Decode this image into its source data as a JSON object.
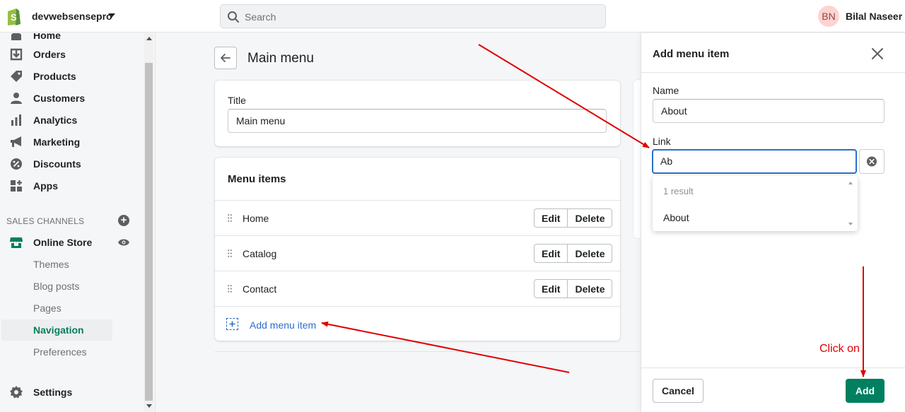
{
  "topbar": {
    "store_name": "devwebsensepro",
    "search_placeholder": "Search",
    "user_initials": "BN",
    "user_name": "Bilal Naseer"
  },
  "sidebar": {
    "items": [
      {
        "label": "Home",
        "icon": "home-icon"
      },
      {
        "label": "Orders",
        "icon": "orders-icon"
      },
      {
        "label": "Products",
        "icon": "tag-icon"
      },
      {
        "label": "Customers",
        "icon": "person-icon"
      },
      {
        "label": "Analytics",
        "icon": "bar-chart-icon"
      },
      {
        "label": "Marketing",
        "icon": "megaphone-icon"
      },
      {
        "label": "Discounts",
        "icon": "discount-icon"
      },
      {
        "label": "Apps",
        "icon": "apps-icon"
      }
    ],
    "section_header": "SALES CHANNELS",
    "channel": "Online Store",
    "sub_items": [
      "Themes",
      "Blog posts",
      "Pages",
      "Navigation",
      "Preferences"
    ],
    "active_sub_item": "Navigation",
    "settings_label": "Settings"
  },
  "main": {
    "page_title": "Main menu",
    "title_label": "Title",
    "title_value": "Main menu",
    "menu_items_header": "Menu items",
    "menu_items": [
      {
        "name": "Home",
        "edit": "Edit",
        "delete": "Delete"
      },
      {
        "name": "Catalog",
        "edit": "Edit",
        "delete": "Delete"
      },
      {
        "name": "Contact",
        "edit": "Edit",
        "delete": "Delete"
      }
    ],
    "add_menu_item": "Add menu item"
  },
  "panel": {
    "title": "Add menu item",
    "name_label": "Name",
    "name_value": "About",
    "link_label": "Link",
    "link_value": "Ab",
    "result_count": "1 result",
    "result_option": "About",
    "cancel_label": "Cancel",
    "add_label": "Add"
  },
  "annotation": {
    "text": "Click on",
    "color": "#e00000"
  },
  "colors": {
    "brand_green": "#008060",
    "active_nav": "#007f5f",
    "link_blue": "#2c6ecb",
    "focus_blue": "#2c6ecb"
  }
}
